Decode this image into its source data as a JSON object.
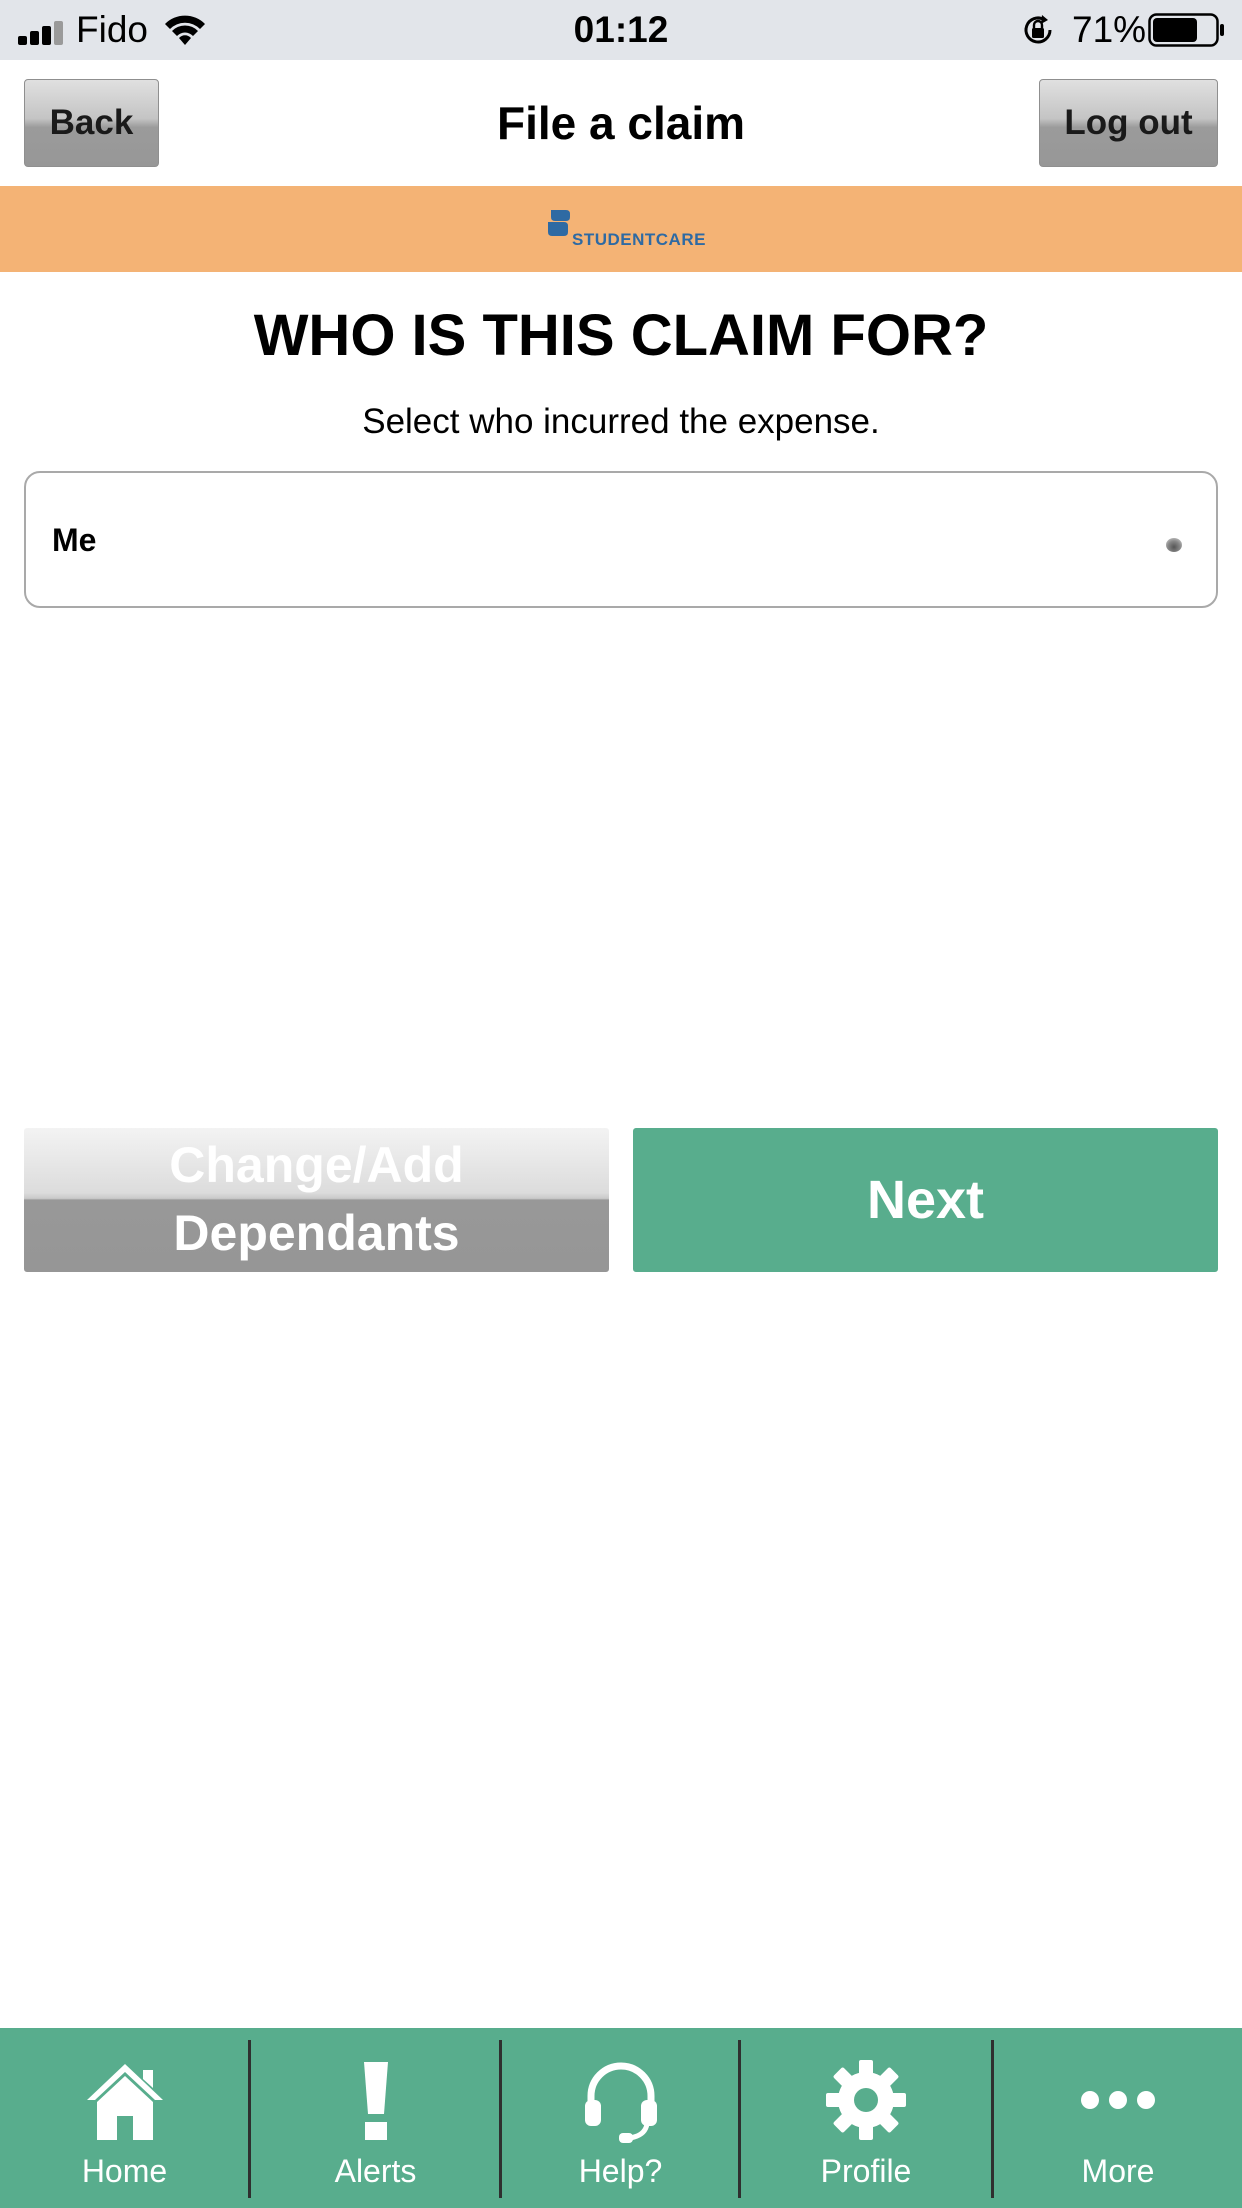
{
  "status_bar": {
    "carrier": "Fido",
    "time": "01:12",
    "battery_percent": "71%",
    "battery_level": 0.71,
    "icons": [
      "signal-icon",
      "wifi-icon",
      "rotation-lock-icon",
      "battery-icon"
    ]
  },
  "header": {
    "title": "File a claim",
    "back_label": "Back",
    "logout_label": "Log out"
  },
  "brand": {
    "logo_text": "STUDENTCARE",
    "banner_color": "#f4b375",
    "logo_color": "#2e6aa3"
  },
  "main": {
    "heading": "WHO IS THIS CLAIM FOR?",
    "subheading": "Select who incurred the expense.",
    "select_value": "Me"
  },
  "actions": {
    "dependants_line1": "Change/Add",
    "dependants_line2": "Dependants",
    "next_label": "Next",
    "accent_color": "#58ad8d"
  },
  "tab_bar": {
    "tabs": [
      {
        "label": "Home",
        "icon": "home-icon"
      },
      {
        "label": "Alerts",
        "icon": "exclamation-icon"
      },
      {
        "label": "Help?",
        "icon": "headset-icon"
      },
      {
        "label": "Profile",
        "icon": "gear-icon"
      },
      {
        "label": "More",
        "icon": "more-dots-icon"
      }
    ]
  }
}
